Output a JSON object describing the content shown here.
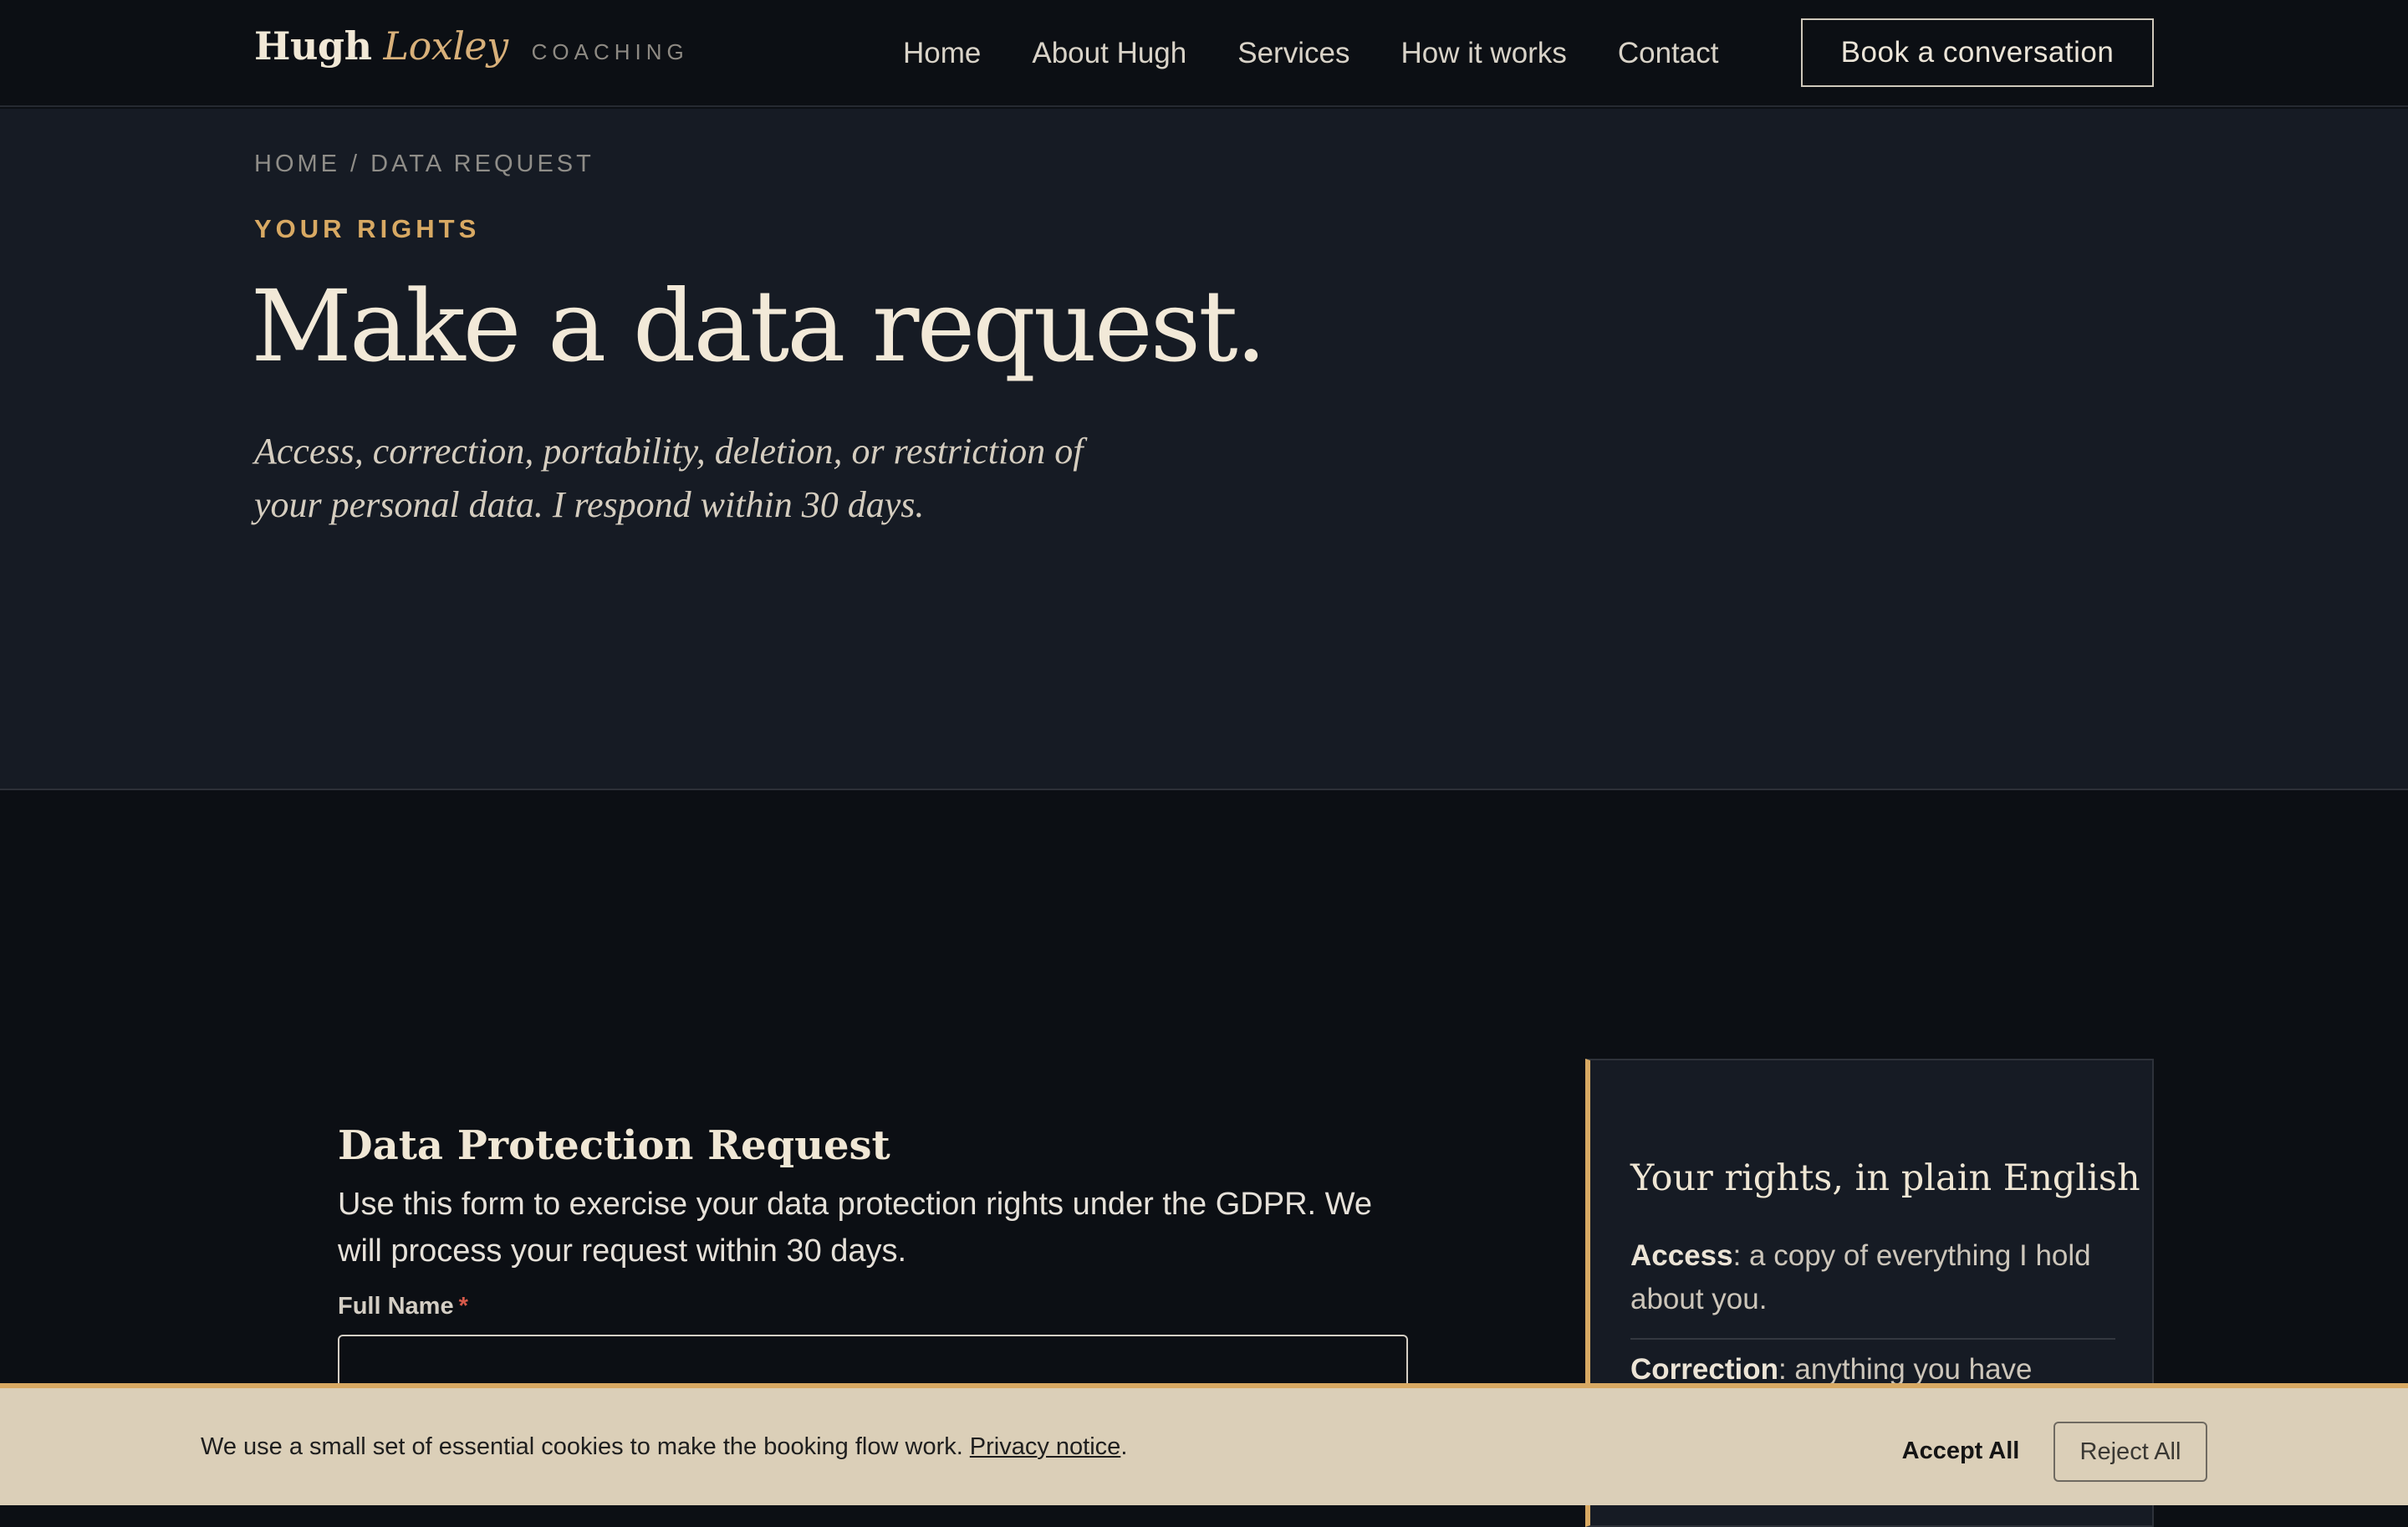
{
  "nav": {
    "brand_first": "Hugh",
    "brand_last": "Loxley",
    "brand_tag": "COACHING",
    "links": [
      "Home",
      "About Hugh",
      "Services",
      "How it works",
      "Contact"
    ],
    "cta": "Book a conversation"
  },
  "hero": {
    "breadcrumb": "HOME / DATA REQUEST",
    "eyebrow": "YOUR RIGHTS",
    "title": "Make a data request.",
    "subtitle": "Access, correction, portability, deletion, or restriction of your personal data. I respond within 30 days."
  },
  "form": {
    "title": "Data Protection Request",
    "description": "Use this form to exercise your data protection rights under the GDPR. We will process your request within 30 days.",
    "full_name_label": "Full Name",
    "required_mark": "*",
    "full_name_value": ""
  },
  "rights": {
    "title": "Your rights, in plain English",
    "items": [
      {
        "term": "Access",
        "text": ": a copy of everything I hold about you."
      },
      {
        "term": "Correction",
        "text": ": anything you have"
      }
    ]
  },
  "cookie": {
    "text": "We use a small set of essential cookies to make the booking flow work.",
    "link": "Privacy notice",
    "period": ".",
    "accept": "Accept All",
    "reject": "Reject All"
  },
  "colors": {
    "accent": "#d8a963",
    "page_bg": "#0c0f14",
    "hero_bg": "#161b24",
    "cookie_bg": "#dbcfb8"
  }
}
